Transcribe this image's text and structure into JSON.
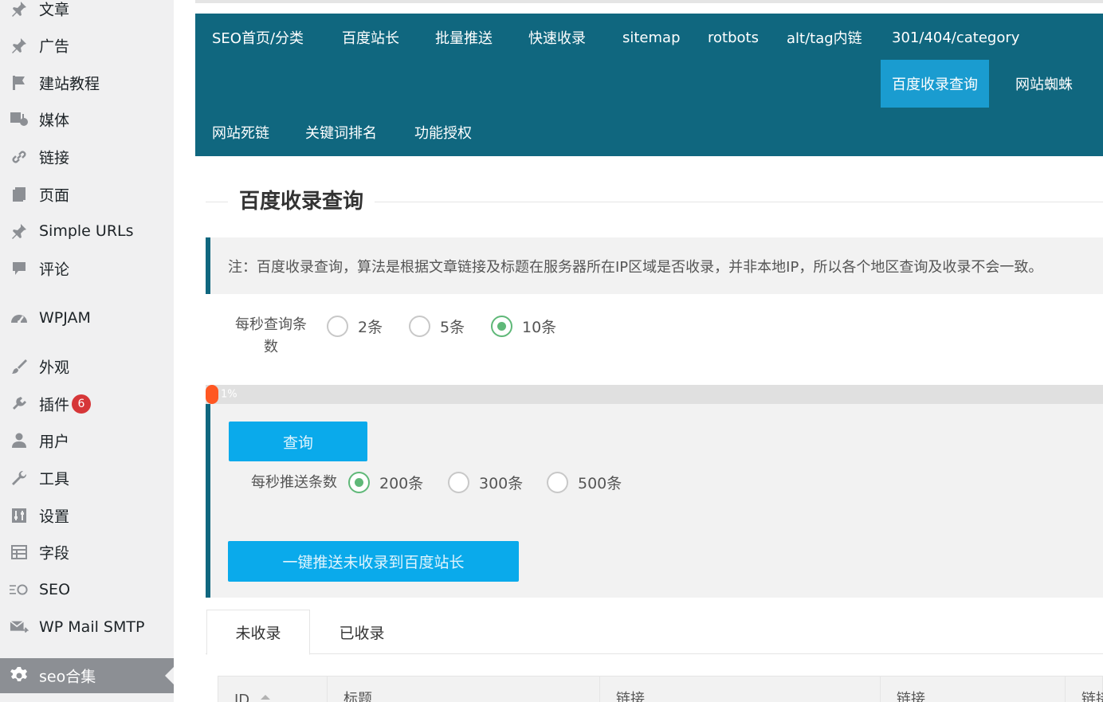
{
  "sidebar": {
    "items": [
      {
        "label": "文章",
        "icon": "pin-icon"
      },
      {
        "label": "广告",
        "icon": "pin-icon"
      },
      {
        "label": "建站教程",
        "icon": "flag-icon"
      },
      {
        "label": "媒体",
        "icon": "media-icon"
      },
      {
        "label": "链接",
        "icon": "link-icon"
      },
      {
        "label": "页面",
        "icon": "page-icon"
      },
      {
        "label": "Simple URLs",
        "icon": "pin-icon"
      },
      {
        "label": "评论",
        "icon": "comment-icon"
      },
      {
        "label": "WPJAM",
        "icon": "gauge-icon"
      },
      {
        "label": "外观",
        "icon": "brush-icon"
      },
      {
        "label": "插件",
        "icon": "plugin-icon",
        "badge": "6"
      },
      {
        "label": "用户",
        "icon": "user-icon"
      },
      {
        "label": "工具",
        "icon": "wrench-icon"
      },
      {
        "label": "设置",
        "icon": "settings-icon"
      },
      {
        "label": "字段",
        "icon": "table-icon"
      },
      {
        "label": "SEO",
        "icon": "seo-icon"
      },
      {
        "label": "WP Mail SMTP",
        "icon": "mail-icon"
      },
      {
        "label": "seo合集",
        "icon": "gear-icon"
      }
    ]
  },
  "nav": {
    "tabs": [
      "SEO首页/分类",
      "百度站长",
      "批量推送",
      "快速收录",
      "sitemap",
      "rotbots",
      "alt/tag内链",
      "301/404/category",
      "百度收录查询",
      "网站蜘蛛",
      "网站死链",
      "关键词排名",
      "功能授权"
    ],
    "active": "百度收录查询"
  },
  "section_title": "百度收录查询",
  "notice": "注：百度收录查询，算法是根据文章链接及标题在服务器所在IP区域是否收录，并非本地IP，所以各个地区查询及收录不会一致。",
  "query_rate": {
    "label": "每秒查询条数",
    "options": [
      "2条",
      "5条",
      "10条"
    ],
    "selected": "10条"
  },
  "progress": {
    "text": "1%",
    "value": 1
  },
  "query_button": "查询",
  "push_rate": {
    "label": "每秒推送条数",
    "options": [
      "200条",
      "300条",
      "500条"
    ],
    "selected": "200条"
  },
  "push_button": "一键推送未收录到百度站长",
  "tabs": [
    "未收录",
    "已收录"
  ],
  "table": {
    "columns": [
      "ID",
      "标题",
      "链接",
      "链接",
      "链接"
    ]
  },
  "colors": {
    "sidebar_bg": "#f0f0f1",
    "nav_bg": "#10677f",
    "nav_active": "#1a9cd0",
    "button": "#0aaaeb",
    "radio_checked": "#5fb878",
    "progress": "#ff5722",
    "badge": "#d63638"
  }
}
